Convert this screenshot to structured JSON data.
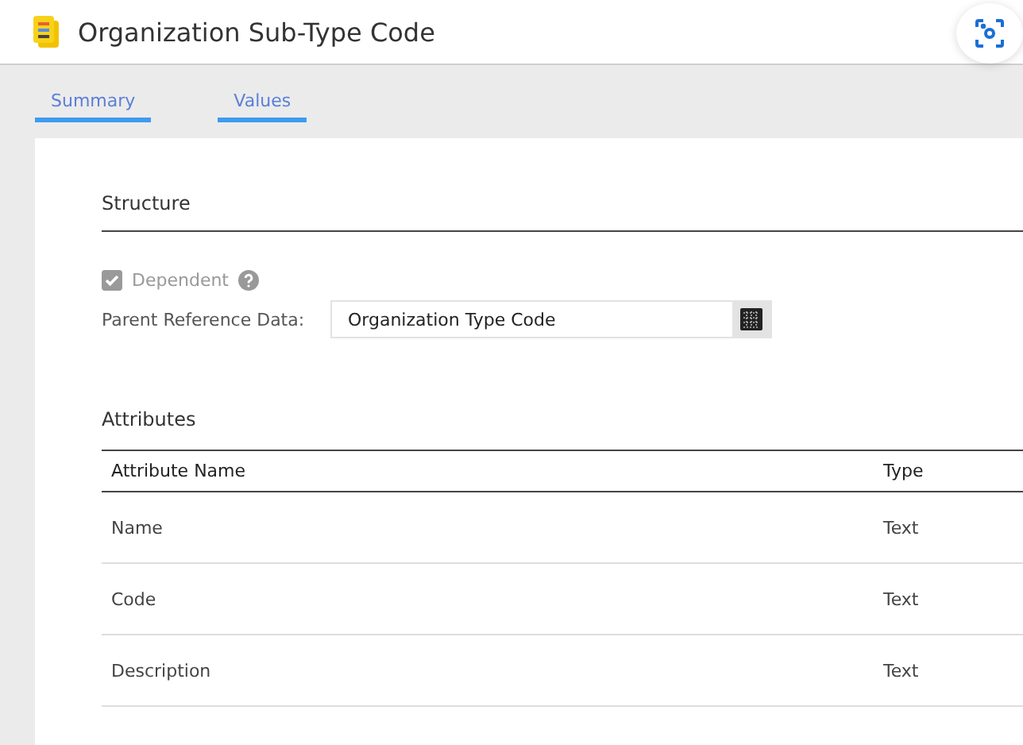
{
  "header": {
    "title": "Organization Sub-Type Code"
  },
  "tabs": [
    {
      "label": "Summary",
      "selected": true
    },
    {
      "label": "Values",
      "selected": true
    }
  ],
  "structure": {
    "heading": "Structure",
    "dependent": {
      "label": "Dependent",
      "checked": true,
      "disabled": true
    },
    "parent_reference": {
      "label": "Parent Reference Data:",
      "value": "Organization Type Code"
    }
  },
  "attributes": {
    "heading": "Attributes",
    "columns": [
      "Attribute Name",
      "Type"
    ],
    "rows": [
      {
        "name": "Name",
        "type": "Text"
      },
      {
        "name": "Code",
        "type": "Text"
      },
      {
        "name": "Description",
        "type": "Text"
      }
    ]
  }
}
